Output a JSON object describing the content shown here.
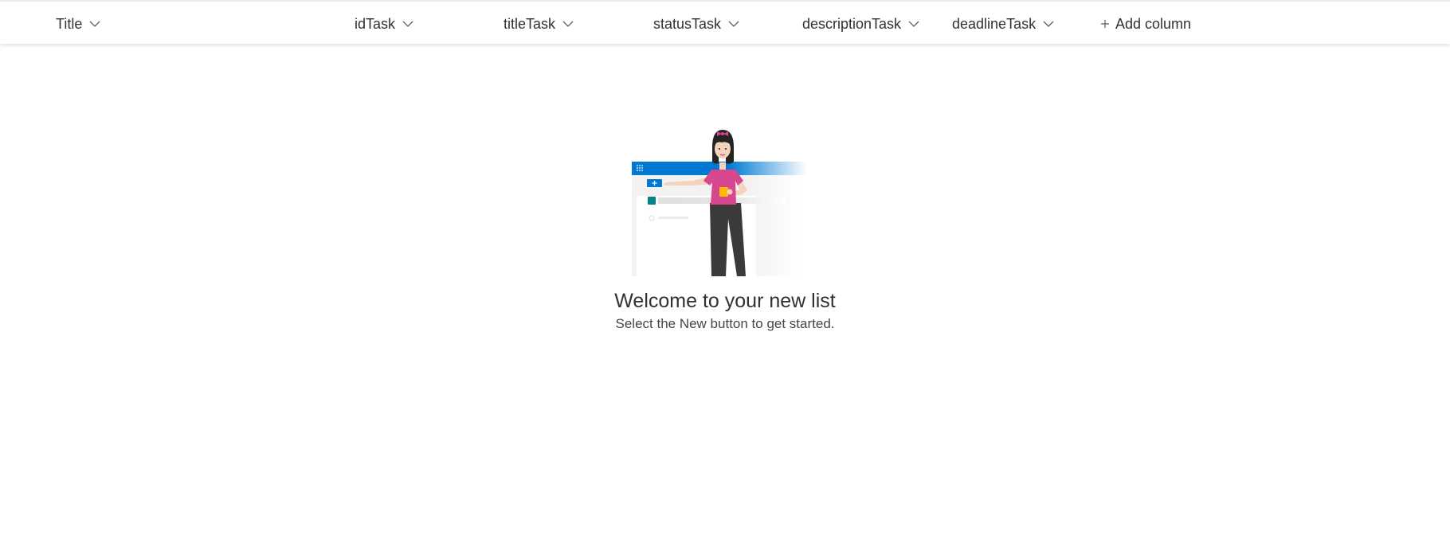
{
  "columns": [
    {
      "label": "Title"
    },
    {
      "label": "idTask"
    },
    {
      "label": "titleTask"
    },
    {
      "label": "statusTask"
    },
    {
      "label": "descriptionTask"
    },
    {
      "label": "deadlineTask"
    }
  ],
  "add_column_label": "Add column",
  "empty_state": {
    "title": "Welcome to your new list",
    "subtitle": "Select the New button to get started."
  },
  "colors": {
    "accent": "#0078d4",
    "text": "#323130",
    "shirt": "#d6478e",
    "teal": "#038387"
  }
}
